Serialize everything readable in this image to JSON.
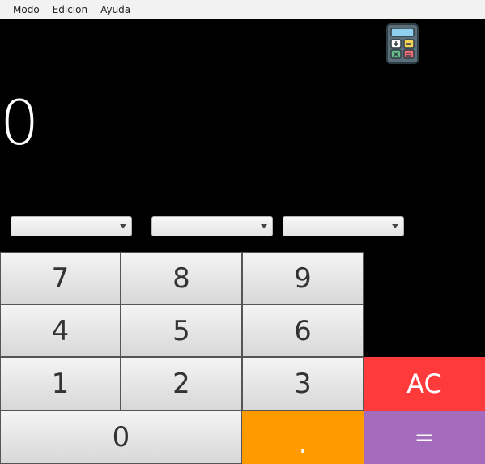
{
  "menubar": {
    "items": [
      {
        "label": "Modo"
      },
      {
        "label": "Edicion"
      },
      {
        "label": "Ayuda"
      }
    ]
  },
  "display": {
    "value": "0"
  },
  "dropdowns": [
    {
      "selected": ""
    },
    {
      "selected": ""
    },
    {
      "selected": ""
    }
  ],
  "keypad": {
    "seven": "7",
    "eight": "8",
    "nine": "9",
    "four": "4",
    "five": "5",
    "six": "6",
    "one": "1",
    "two": "2",
    "three": "3",
    "zero": "0",
    "dot": ".",
    "ac": "AC",
    "equals": "="
  },
  "colors": {
    "ac": "#ff3a3a",
    "dot": "#ff9a00",
    "equals": "#a56bbd",
    "display_bg": "#000000"
  },
  "icons": {
    "app": "calculator-icon"
  }
}
